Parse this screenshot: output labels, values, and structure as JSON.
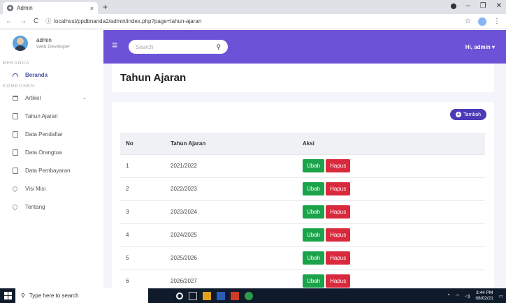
{
  "browser": {
    "tab_title": "Admin",
    "tab_close": "×",
    "new_tab": "+",
    "url": "localhost/ppdbnanda2/admin/index.php?page=tahun-ajaran"
  },
  "topnav": {
    "search_placeholder": "Search",
    "greeting": "Hi, admin ▾"
  },
  "user": {
    "name": "admin",
    "role": "Web Developer"
  },
  "sidebar": {
    "section_beranda": "BERANDA",
    "section_komponen": "KOMPONEN",
    "items": [
      {
        "label": "Beranda",
        "icon": "gauge-icon"
      },
      {
        "label": "Artikel",
        "icon": "window-icon"
      },
      {
        "label": "Tahun Ajaran",
        "icon": "document-icon"
      },
      {
        "label": "Data Pendaftar",
        "icon": "document-icon"
      },
      {
        "label": "Data Orangtua",
        "icon": "document-icon"
      },
      {
        "label": "Data Pembayaran",
        "icon": "document-icon"
      },
      {
        "label": "Visi Misi",
        "icon": "pin-icon"
      },
      {
        "label": "Tentang",
        "icon": "pin-icon"
      }
    ]
  },
  "page": {
    "title": "Tahun Ajaran",
    "add_button": "Tambah",
    "table": {
      "headers": [
        "No",
        "Tahun Ajaran",
        "Aksi"
      ],
      "rows": [
        {
          "no": "1",
          "tahun": "2021/2022"
        },
        {
          "no": "2",
          "tahun": "2022/2023"
        },
        {
          "no": "3",
          "tahun": "2023/2024"
        },
        {
          "no": "4",
          "tahun": "2024/2025"
        },
        {
          "no": "5",
          "tahun": "2025/2026"
        },
        {
          "no": "6",
          "tahun": "2026/2027"
        }
      ],
      "edit_label": "Ubah",
      "delete_label": "Hapus"
    }
  },
  "taskbar": {
    "search_placeholder": "Type here to search",
    "time": "3:44 PM",
    "date": "08/02/21"
  },
  "colors": {
    "topnav": "#6c52d6",
    "add_button": "#4b3bb8",
    "edit": "#1aa34a",
    "delete": "#d9293d"
  }
}
